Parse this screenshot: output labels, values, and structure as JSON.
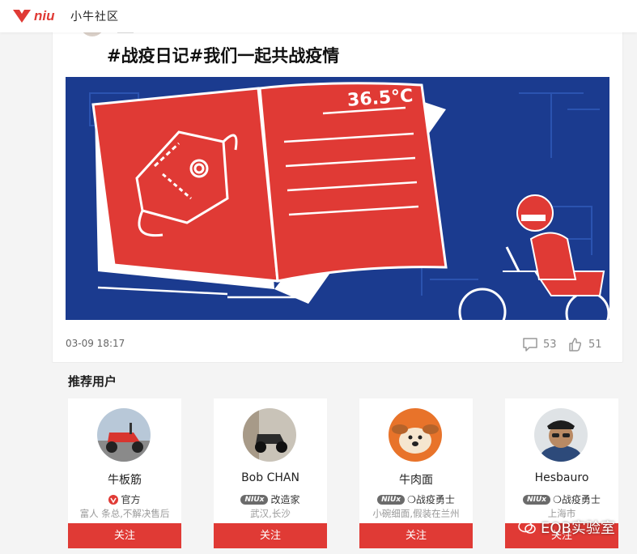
{
  "header": {
    "brand": "niu",
    "community_label": "小牛社区",
    "accent_color": "#e03a35"
  },
  "post": {
    "title": "#战疫日记#我们一起共战疫情",
    "banner_temperature": "36.5°C",
    "time": "03-09 18:17",
    "comments": "53",
    "likes": "51"
  },
  "recommend": {
    "title": "推荐用户",
    "users": [
      {
        "name": "牛板筋",
        "badge_type": "official",
        "badge_label": "官方",
        "tag": "",
        "bio": "富人 条总,不解决售后",
        "button": "关注",
        "avatar": "scooter-photo"
      },
      {
        "name": "Bob CHAN",
        "badge_type": "niux",
        "tag": "NIUx",
        "badge_label": "改造家",
        "bio": "武汉,长沙",
        "button": "关注",
        "avatar": "scooter-photo"
      },
      {
        "name": "牛肉面",
        "badge_type": "niux",
        "tag": "NIUx",
        "badge_label": "❍战疫勇士",
        "bio": "小碗细面,假装在兰州",
        "button": "关注",
        "avatar": "dog-photo"
      },
      {
        "name": "Hesbauro",
        "badge_type": "niux",
        "tag": "NIUx",
        "badge_label": "❍战疫勇士",
        "bio": "上海市",
        "button": "关注",
        "avatar": "person-photo"
      }
    ]
  },
  "watermark": "EQB实验室"
}
